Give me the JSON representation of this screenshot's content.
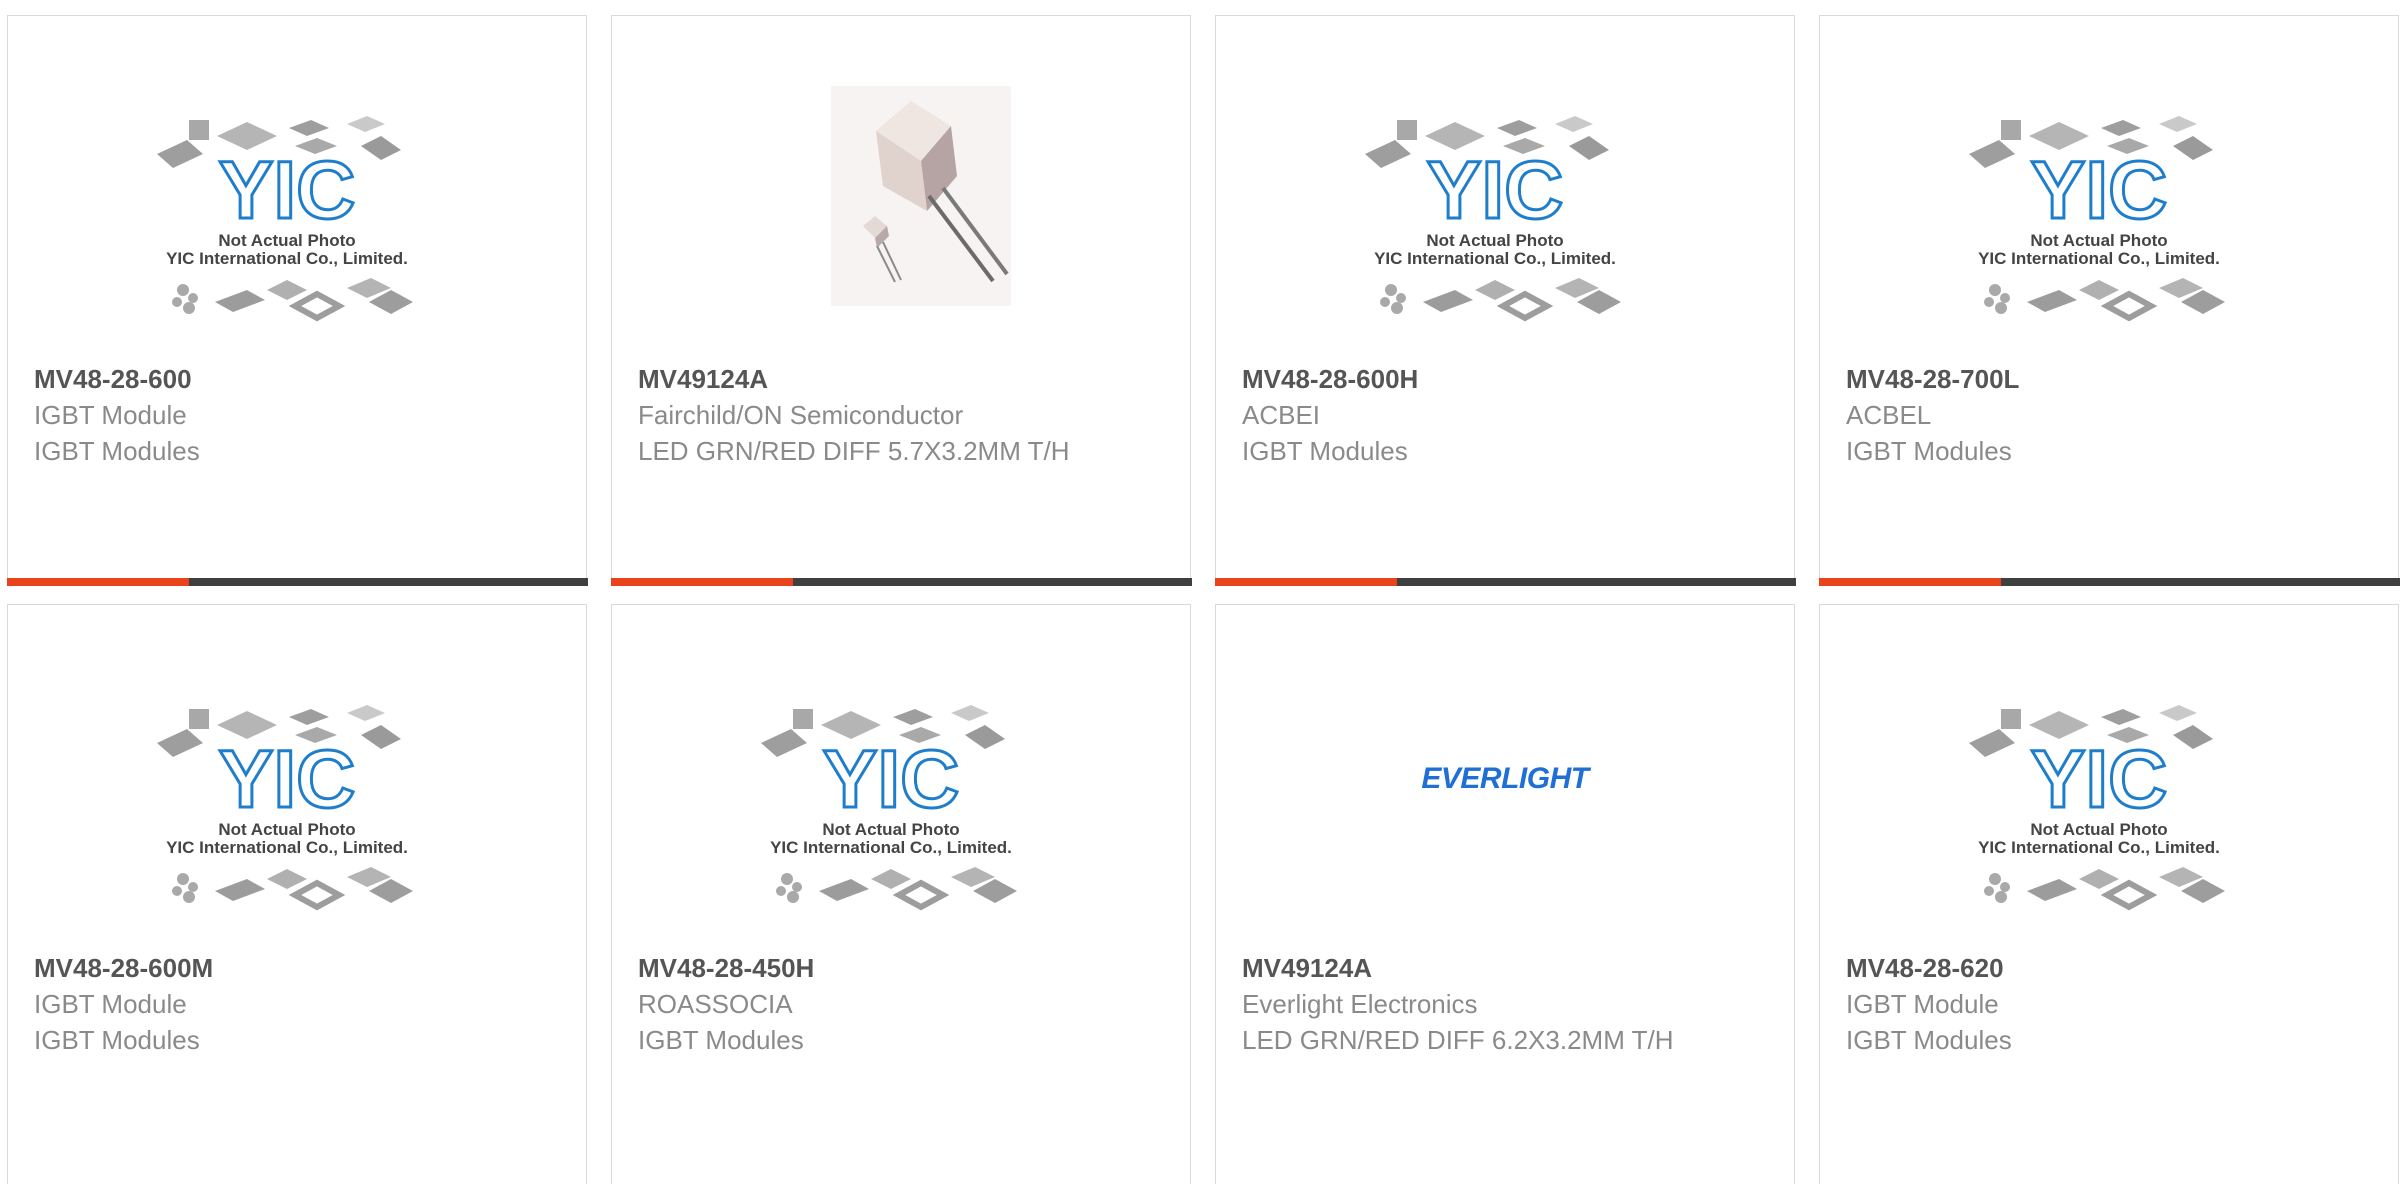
{
  "colors": {
    "accent": "#e8431a",
    "bar": "#3f3f3f",
    "yic_blue": "#1f7ecb",
    "everlight_blue": "#1f6fd6"
  },
  "placeholder": {
    "line1": "Not Actual Photo",
    "line2": "YIC International Co., Limited.",
    "logo": "YIC"
  },
  "products": [
    {
      "part": "MV48-28-600",
      "maker": "IGBT Module",
      "category": "IGBT Modules",
      "image": "yic-placeholder"
    },
    {
      "part": "MV49124A",
      "maker": "Fairchild/ON Semiconductor",
      "category": "LED GRN/RED DIFF 5.7X3.2MM T/H",
      "image": "led-photo"
    },
    {
      "part": "MV48-28-600H",
      "maker": "ACBEI",
      "category": "IGBT Modules",
      "image": "yic-placeholder"
    },
    {
      "part": "MV48-28-700L",
      "maker": "ACBEL",
      "category": "IGBT Modules",
      "image": "yic-placeholder"
    },
    {
      "part": "MV48-28-600M",
      "maker": "IGBT Module",
      "category": "IGBT Modules",
      "image": "yic-placeholder"
    },
    {
      "part": "MV48-28-450H",
      "maker": "ROASSOCIA",
      "category": "IGBT Modules",
      "image": "yic-placeholder"
    },
    {
      "part": "MV49124A",
      "maker": "Everlight Electronics",
      "category": "LED GRN/RED DIFF 6.2X3.2MM T/H",
      "image": "everlight-logo",
      "logo_text": "EVERLIGHT"
    },
    {
      "part": "MV48-28-620",
      "maker": "IGBT Module",
      "category": "IGBT Modules",
      "image": "yic-placeholder"
    }
  ]
}
